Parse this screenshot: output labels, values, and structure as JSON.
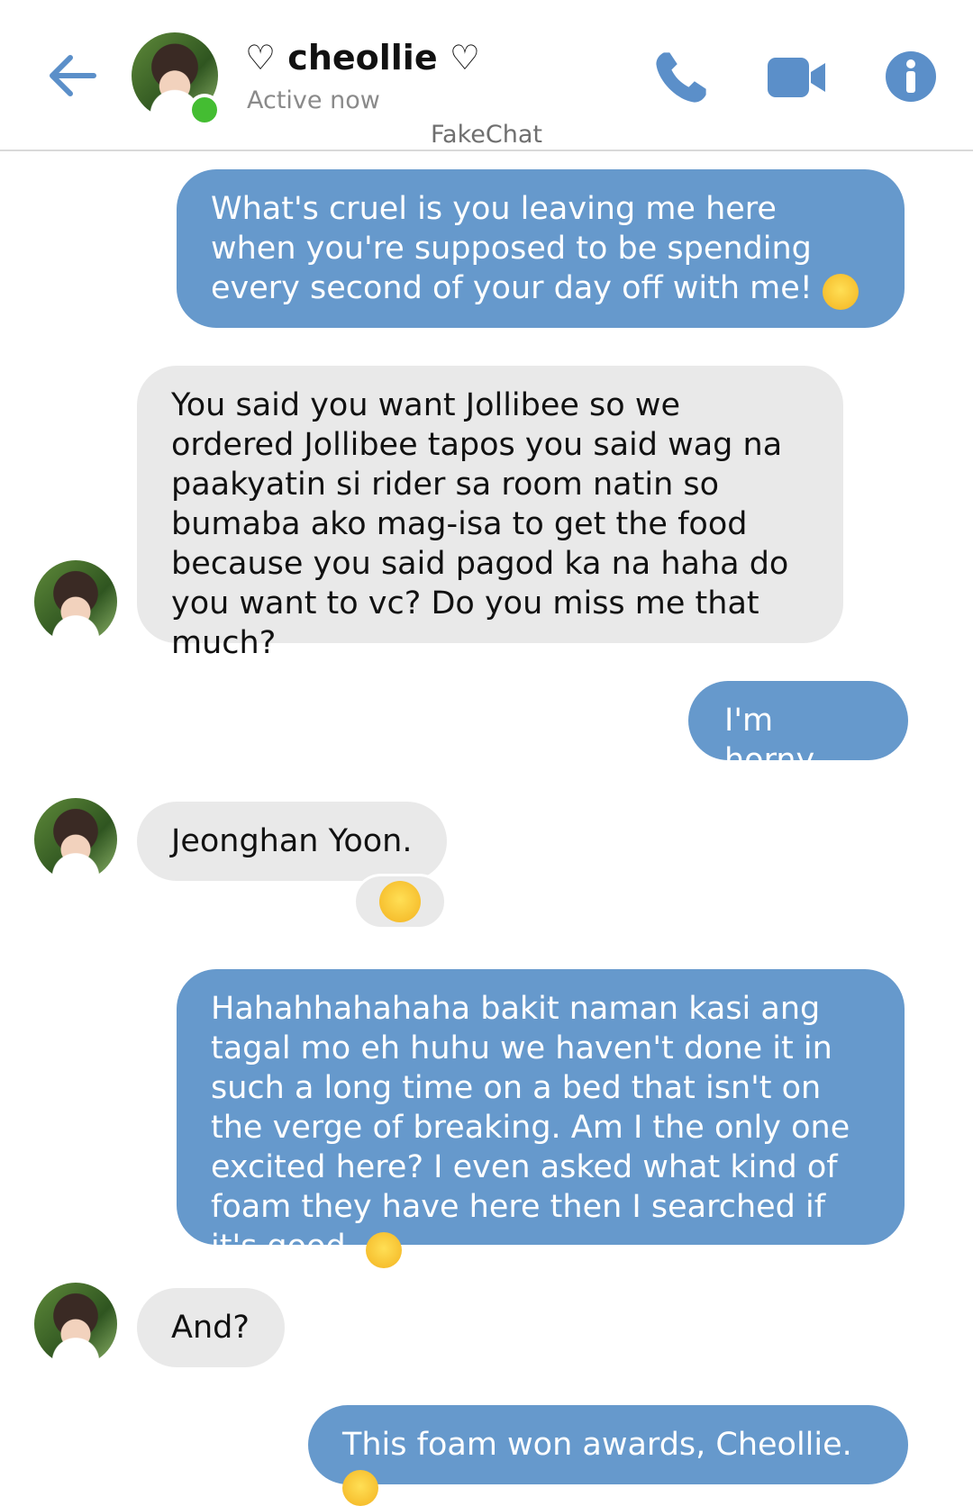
{
  "header": {
    "contact_name": "♡ cheollie ♡",
    "status": "Active now",
    "watermark": "FakeChat",
    "icons": [
      "back-arrow-icon",
      "phone-icon",
      "video-camera-icon",
      "info-icon"
    ],
    "accent_color": "#5b8fc9",
    "online_color": "#44bd32"
  },
  "messages": [
    {
      "from": "me",
      "text": "What's cruel is you leaving me here when you're supposed to be spending every second of your day off with me!",
      "emoji": "😤"
    },
    {
      "from": "contact",
      "text": "You said you want Jollibee so we ordered Jollibee tapos you said wag na paakyatin si rider sa room natin so bumaba ako mag-isa to get the food because you said pagod ka na haha do you want to vc? Do you miss me that much?"
    },
    {
      "from": "me",
      "text": "I'm horny."
    },
    {
      "from": "contact",
      "text": "Jeonghan Yoon.",
      "reaction": "😆"
    },
    {
      "from": "me",
      "text": "Hahahhahahaha bakit naman kasi ang tagal mo eh huhu we haven't done it in such a long time on a bed that isn't on the verge of breaking. Am I the only one excited here? I even asked what kind of foam they have here then I searched if it's good.",
      "emoji": "😭"
    },
    {
      "from": "contact",
      "text": "And?"
    },
    {
      "from": "me",
      "text": "This foam won awards, Cheollie.",
      "emoji": "😭"
    }
  ],
  "colors": {
    "sent_bubble": "#6699cc",
    "received_bubble": "#e9e9e9"
  }
}
